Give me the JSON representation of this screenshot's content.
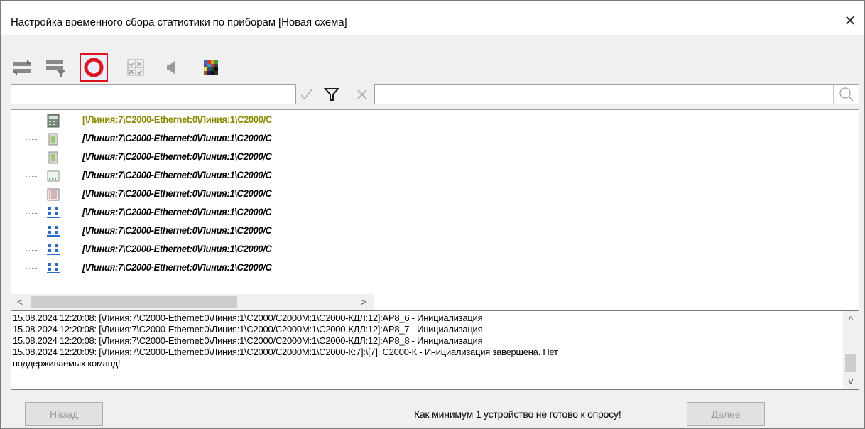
{
  "window": {
    "title": "Настройка временного сбора статистики по приборам [Новая схема]",
    "close_glyph": "✕"
  },
  "toolbar": {
    "buttons": [
      {
        "name": "refresh-icon"
      },
      {
        "name": "refresh-filter-icon"
      },
      {
        "name": "stop-icon",
        "highlighted": true
      },
      {
        "name": "checklist-icon"
      },
      {
        "name": "speaker-icon"
      },
      {
        "name": "color-palette-icon"
      }
    ]
  },
  "filter": {
    "left_value": "",
    "right_value": "",
    "icons": [
      "checkmark-icon",
      "filter-icon",
      "clear-filter-icon",
      "search-icon"
    ]
  },
  "tree": {
    "rows": [
      {
        "icon": "device-panel-icon",
        "label": "[\\Линия:7\\С2000-Ethernet:0\\Линия:1\\С2000/С",
        "style": "root"
      },
      {
        "icon": "relay-icon",
        "label": "[\\Линия:7\\С2000-Ethernet:0\\Линия:1\\С2000/С"
      },
      {
        "icon": "relay-icon",
        "label": "[\\Линия:7\\С2000-Ethernet:0\\Линия:1\\С2000/С"
      },
      {
        "icon": "keypad-icon",
        "label": "[\\Линия:7\\С2000-Ethernet:0\\Линия:1\\С2000/С"
      },
      {
        "icon": "grid-device-icon",
        "label": "[\\Линия:7\\С2000-Ethernet:0\\Линия:1\\С2000/С"
      },
      {
        "icon": "network-node-icon",
        "label": "[\\Линия:7\\С2000-Ethernet:0\\Линия:1\\С2000/С"
      },
      {
        "icon": "network-node-icon",
        "label": "[\\Линия:7\\С2000-Ethernet:0\\Линия:1\\С2000/С"
      },
      {
        "icon": "network-node-icon",
        "label": "[\\Линия:7\\С2000-Ethernet:0\\Линия:1\\С2000/С"
      },
      {
        "icon": "network-node-icon",
        "label": "[\\Линия:7\\С2000-Ethernet:0\\Линия:1\\С2000/С"
      }
    ],
    "scroll_left": "<",
    "scroll_right": ">"
  },
  "log": {
    "lines": [
      "15.08.2024 12:20:08: [\\Линия:7\\С2000-Ethernet:0\\Линия:1\\С2000/С2000М:1\\С2000-КДЛ:12]:АР8_6 - Инициализация",
      "15.08.2024 12:20:08: [\\Линия:7\\С2000-Ethernet:0\\Линия:1\\С2000/С2000М:1\\С2000-КДЛ:12]:АР8_7 - Инициализация",
      "15.08.2024 12:20:08: [\\Линия:7\\С2000-Ethernet:0\\Линия:1\\С2000/С2000М:1\\С2000-КДЛ:12]:АР8_8 - Инициализация",
      "15.08.2024 12:20:09: [\\Линия:7\\С2000-Ethernet:0\\Линия:1\\С2000/С2000М:1\\С2000-К:7]:\\[7]: С2000-К - Инициализация завершена. Нет",
      "поддерживаемых команд!"
    ],
    "scroll_up": "^",
    "scroll_down": "v"
  },
  "footer": {
    "back_label": "Назад",
    "next_label": "Далее",
    "status_text": "Как минимум 1 устройство не готово к опросу!"
  },
  "colors": {
    "highlight_border": "#e0141e",
    "root_label": "#8a8a00",
    "stop_red": "#e0141e"
  }
}
